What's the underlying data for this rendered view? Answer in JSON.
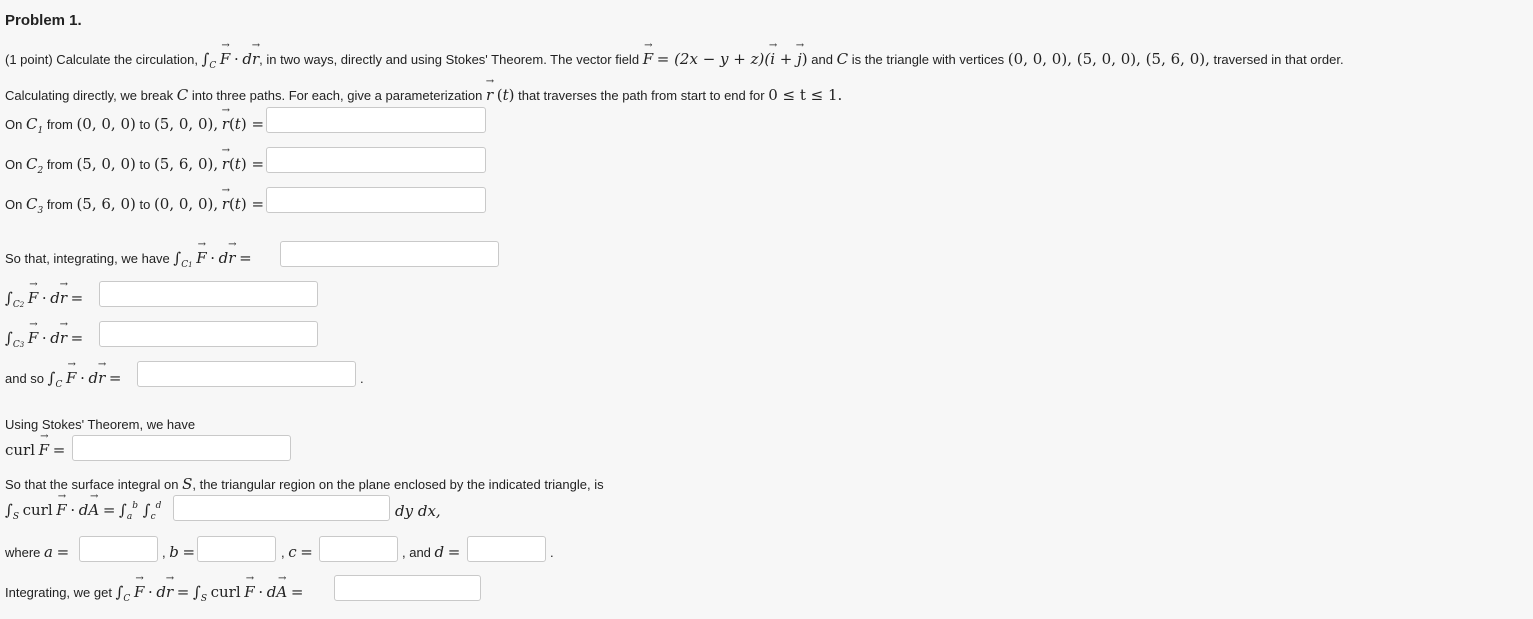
{
  "title": "Problem 1.",
  "intro": {
    "points": "(1 point) Calculate the circulation,",
    "text2": "in two ways, directly and using Stokes' Theorem. The vector field",
    "field_expr": "= (2x − y + z)(",
    "and_c": "and",
    "is_triangle": "is the triangle with vertices",
    "vertices": "(0, 0, 0), (5, 0, 0), (5, 6, 0),",
    "traversed": "traversed in that order."
  },
  "direct": {
    "line1": "Calculating directly, we break",
    "line1b": "into three paths. For each, give a parameterization",
    "line1c": "that traverses the path from start to end for",
    "trange": "0 ≤ t ≤ 1.",
    "paths": [
      {
        "prefix": "On",
        "sub": "1",
        "from_word": "from",
        "from": "(0, 0, 0)",
        "to_word": "to",
        "to": "(5, 0, 0),"
      },
      {
        "prefix": "On",
        "sub": "2",
        "from_word": "from",
        "from": "(5, 0, 0)",
        "to_word": "to",
        "to": "(5, 6, 0),"
      },
      {
        "prefix": "On",
        "sub": "3",
        "from_word": "from",
        "from": "(5, 6, 0)",
        "to_word": "to",
        "to": "(0, 0, 0),"
      }
    ],
    "integrating_label": "So that, integrating, we have",
    "and_so_label": "and so"
  },
  "stokes": {
    "heading": "Using Stokes' Theorem, we have",
    "curl_label": "curl",
    "surface_text": "So that the surface integral on",
    "surface_text2": "the triangular region on the plane enclosed by the indicated triangle, is",
    "dydx": "dy dx,",
    "where_label": "where",
    "and_label": ", and",
    "final_label": "Integrating, we get"
  },
  "answers": {
    "r1": "",
    "r2": "",
    "r3": "",
    "int1": "",
    "int2": "",
    "int3": "",
    "total": "",
    "curl": "",
    "integrand": "",
    "a": "",
    "b": "",
    "c": "",
    "d": "",
    "final": ""
  }
}
